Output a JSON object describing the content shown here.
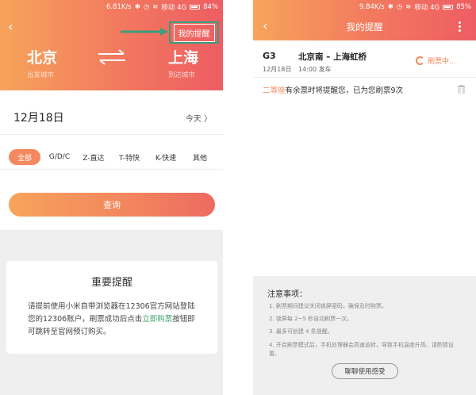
{
  "left": {
    "status": {
      "speed": "6.81K/s",
      "network": "移动 4G",
      "battery": "84%"
    },
    "reminder_button": "我的提醒",
    "from_city": "北京",
    "from_label": "出发城市",
    "to_city": "上海",
    "to_label": "到达城市",
    "date": "12月18日",
    "today": "今天",
    "filters": [
      "全部",
      "G/D/C",
      "Z-直达",
      "T-特快",
      "K-快速",
      "其他"
    ],
    "query_button": "查询",
    "notice": {
      "title": "重要提醒",
      "body_before": "请提前使用小米自带浏览器在12306官方网站登陆您的12306账户，刷票成功后点击",
      "link": "立即购票",
      "body_after": "按钮即可跳转至官网预订购买。"
    }
  },
  "right": {
    "status": {
      "speed": "9.84K/s",
      "network": "移动 4G",
      "battery": "85%"
    },
    "title": "我的提醒",
    "train": {
      "number": "G3",
      "date": "12月18日",
      "route": "北京南 – 上海虹桥",
      "depart": "14:00 发车",
      "status": "刷票中..."
    },
    "remind": {
      "seat": "二等座",
      "text": "有余票时将提醒您，已为您刷票9次"
    },
    "tips_title": "注意事项：",
    "tips": [
      "1. 刷票期间建议关闭锁屏密码，确保及时购票。",
      "2. 锁屏每 2~5 秒自动刷票一次。",
      "3. 最多可创建 4 条提醒。",
      "4. 开启刷票模式后，手机处理器会高速运转，导致手机温度升高、请酌情设置。"
    ],
    "feedback_button": "聊聊使用感受"
  },
  "colors": {
    "accent": "#f4885f",
    "gradient_start": "#f7a45b",
    "gradient_end": "#ee5d63",
    "highlight": "#3a9d7d",
    "link": "#3aa06a"
  }
}
